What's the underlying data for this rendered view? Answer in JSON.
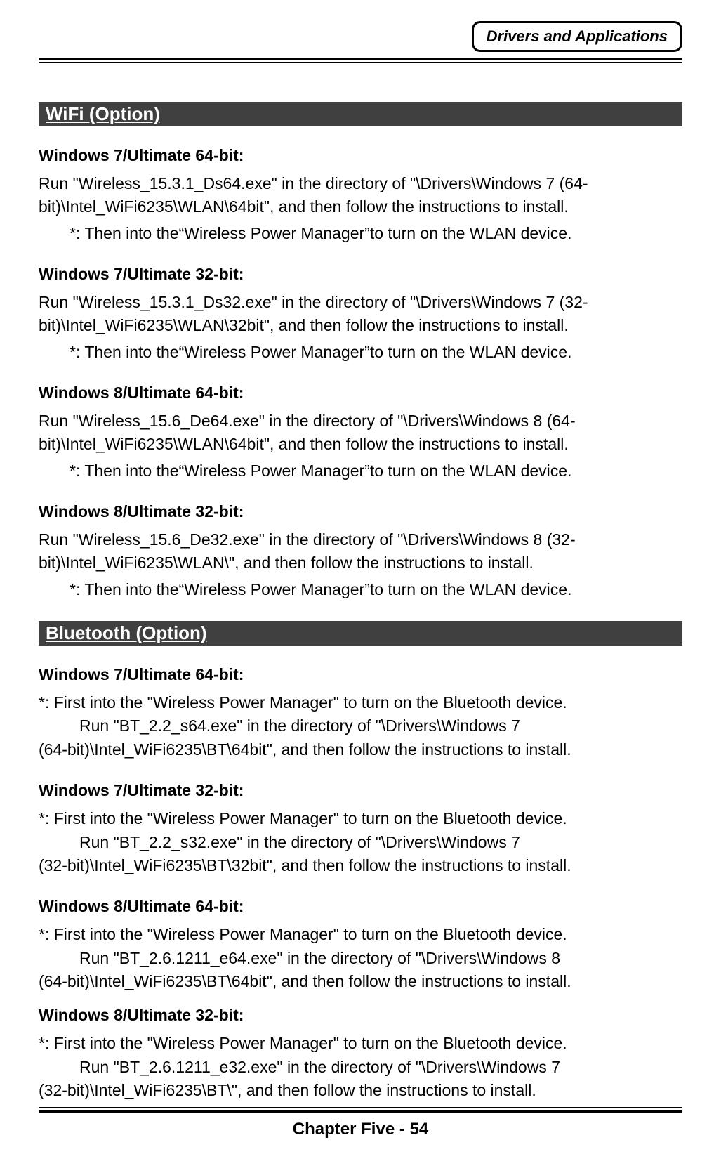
{
  "header": {
    "badge": "Drivers and Applications"
  },
  "wifi": {
    "title": " WiFi (Option)",
    "sections": [
      {
        "title": "Windows 7/Ultimate 64-bit:",
        "body": "Run \"Wireless_15.3.1_Ds64.exe\" in the directory of \"\\Drivers\\Windows 7 (64-bit)\\Intel_WiFi6235\\WLAN\\64bit\", and then follow the instructions to install.",
        "note": "*: Then into the“Wireless Power Manager”to turn on the WLAN device."
      },
      {
        "title": "Windows 7/Ultimate 32-bit:",
        "body": "Run \"Wireless_15.3.1_Ds32.exe\" in the directory of \"\\Drivers\\Windows 7 (32-bit)\\Intel_WiFi6235\\WLAN\\32bit\", and then follow the instructions to install.",
        "note": "*: Then into the“Wireless Power Manager”to turn on the WLAN device."
      },
      {
        "title": "Windows 8/Ultimate 64-bit:",
        "body": "Run \"Wireless_15.6_De64.exe\" in the directory of \"\\Drivers\\Windows 8 (64-bit)\\Intel_WiFi6235\\WLAN\\64bit\", and then follow the instructions to install.",
        "note": "*: Then into the“Wireless Power Manager”to turn on the WLAN device."
      },
      {
        "title": "Windows 8/Ultimate 32-bit:",
        "body": "Run \"Wireless_15.6_De32.exe\" in the directory of \"\\Drivers\\Windows 8 (32-bit)\\Intel_WiFi6235\\WLAN\\\", and then follow the instructions to install.",
        "note": "*: Then into the“Wireless Power Manager”to turn on the WLAN device."
      }
    ]
  },
  "bluetooth": {
    "title": " Bluetooth (Option)",
    "sections": [
      {
        "title": "Windows 7/Ultimate 64-bit:",
        "first": "*: First into the \"Wireless Power Manager\" to turn on the Bluetooth device.",
        "run": "Run \"BT_2.2_s64.exe\" in the directory of \"\\Drivers\\Windows 7",
        "cont": "(64-bit)\\Intel_WiFi6235\\BT\\64bit\", and then follow the instructions to install."
      },
      {
        "title": "Windows 7/Ultimate 32-bit:",
        "first": "*: First into the \"Wireless Power Manager\" to turn on the Bluetooth device.",
        "run": "Run \"BT_2.2_s32.exe\" in the directory of \"\\Drivers\\Windows 7",
        "cont": "(32-bit)\\Intel_WiFi6235\\BT\\32bit\", and then follow the instructions to install."
      },
      {
        "title": "Windows 8/Ultimate 64-bit:",
        "first": "*: First into the \"Wireless Power Manager\" to turn on the Bluetooth device.",
        "run": "Run \"BT_2.6.1211_e64.exe\" in the directory of \"\\Drivers\\Windows 8",
        "cont": "(64-bit)\\Intel_WiFi6235\\BT\\64bit\", and then follow the instructions to install."
      },
      {
        "title": "Windows 8/Ultimate 32-bit:",
        "first": "*: First into the \"Wireless Power Manager\" to turn on the Bluetooth device.",
        "run": "Run \"BT_2.6.1211_e32.exe\" in the directory of \"\\Drivers\\Windows 7",
        "cont": "(32-bit)\\Intel_WiFi6235\\BT\\\", and then follow the instructions to install."
      }
    ]
  },
  "footer": {
    "text": "Chapter Five - 54"
  }
}
